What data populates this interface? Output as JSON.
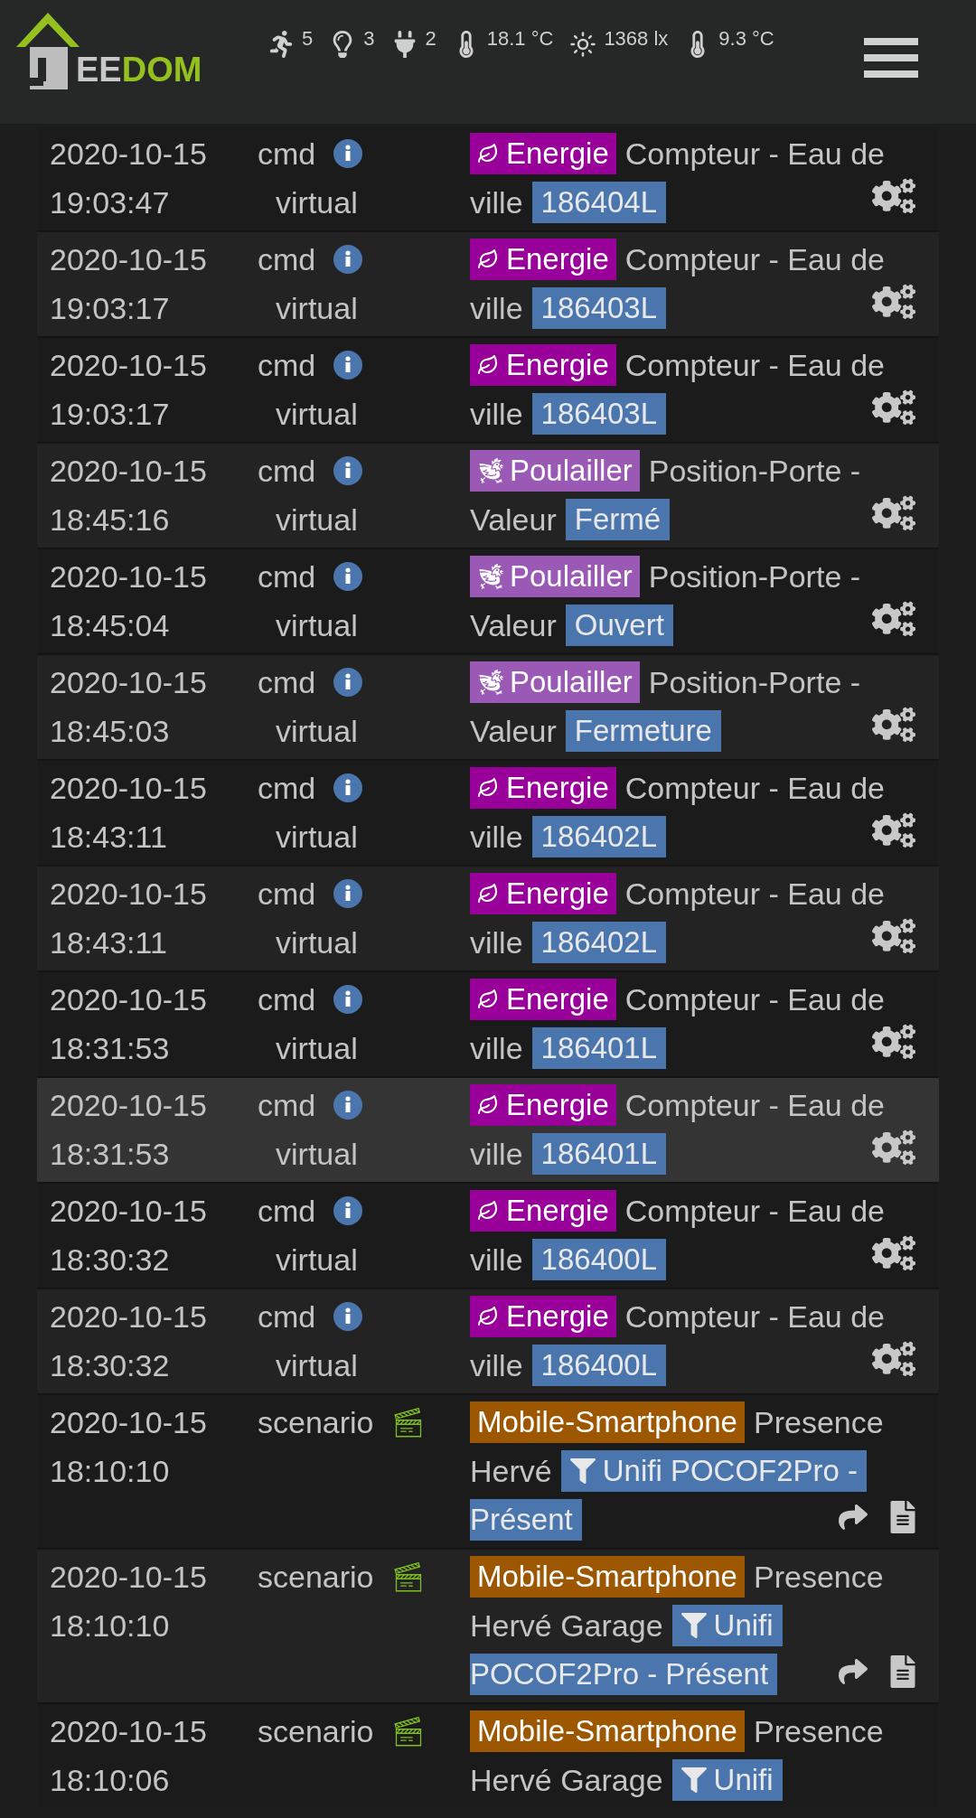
{
  "header": {
    "logo": {
      "grey": "EE",
      "green": "DOM"
    },
    "status": [
      {
        "kind": "motion",
        "value": "5"
      },
      {
        "kind": "light",
        "value": "3"
      },
      {
        "kind": "plug",
        "value": "2"
      },
      {
        "kind": "thermometer",
        "value": "18.1 °C"
      },
      {
        "kind": "sun",
        "value": "1368 lx"
      },
      {
        "kind": "thermometer",
        "value": "9.3 °C"
      }
    ]
  },
  "rows": [
    {
      "kind": "cmd",
      "date": "2020-10-15",
      "time": "19:03:47",
      "type": "cmd",
      "subtype": "virtual",
      "tag": {
        "kind": "energy",
        "label": "Energie",
        "color": "#990099"
      },
      "text": [
        "Compteur - Eau de",
        "ville"
      ],
      "value": [
        "186404L"
      ],
      "selected": false
    },
    {
      "kind": "cmd",
      "date": "2020-10-15",
      "time": "19:03:17",
      "type": "cmd",
      "subtype": "virtual",
      "tag": {
        "kind": "energy",
        "label": "Energie",
        "color": "#990099"
      },
      "text": [
        "Compteur - Eau de",
        "ville"
      ],
      "value": [
        "186403L"
      ],
      "selected": false
    },
    {
      "kind": "cmd",
      "date": "2020-10-15",
      "time": "19:03:17",
      "type": "cmd",
      "subtype": "virtual",
      "tag": {
        "kind": "energy",
        "label": "Energie",
        "color": "#990099"
      },
      "text": [
        "Compteur - Eau de",
        "ville"
      ],
      "value": [
        "186403L"
      ],
      "selected": false
    },
    {
      "kind": "cmd",
      "date": "2020-10-15",
      "time": "18:45:16",
      "type": "cmd",
      "subtype": "virtual",
      "tag": {
        "kind": "chicken",
        "label": "Poulailler",
        "color": "#9b59b6"
      },
      "text": [
        "Position-Porte -",
        "Valeur"
      ],
      "value": [
        "Fermé"
      ],
      "selected": false
    },
    {
      "kind": "cmd",
      "date": "2020-10-15",
      "time": "18:45:04",
      "type": "cmd",
      "subtype": "virtual",
      "tag": {
        "kind": "chicken",
        "label": "Poulailler",
        "color": "#9b59b6"
      },
      "text": [
        "Position-Porte -",
        "Valeur"
      ],
      "value": [
        "Ouvert"
      ],
      "selected": false
    },
    {
      "kind": "cmd",
      "date": "2020-10-15",
      "time": "18:45:03",
      "type": "cmd",
      "subtype": "virtual",
      "tag": {
        "kind": "chicken",
        "label": "Poulailler",
        "color": "#9b59b6"
      },
      "text": [
        "Position-Porte -",
        "Valeur"
      ],
      "value": [
        "Fermeture"
      ],
      "selected": false
    },
    {
      "kind": "cmd",
      "date": "2020-10-15",
      "time": "18:43:11",
      "type": "cmd",
      "subtype": "virtual",
      "tag": {
        "kind": "energy",
        "label": "Energie",
        "color": "#990099"
      },
      "text": [
        "Compteur - Eau de",
        "ville"
      ],
      "value": [
        "186402L"
      ],
      "selected": false
    },
    {
      "kind": "cmd",
      "date": "2020-10-15",
      "time": "18:43:11",
      "type": "cmd",
      "subtype": "virtual",
      "tag": {
        "kind": "energy",
        "label": "Energie",
        "color": "#990099"
      },
      "text": [
        "Compteur - Eau de",
        "ville"
      ],
      "value": [
        "186402L"
      ],
      "selected": false
    },
    {
      "kind": "cmd",
      "date": "2020-10-15",
      "time": "18:31:53",
      "type": "cmd",
      "subtype": "virtual",
      "tag": {
        "kind": "energy",
        "label": "Energie",
        "color": "#990099"
      },
      "text": [
        "Compteur - Eau de",
        "ville"
      ],
      "value": [
        "186401L"
      ],
      "selected": false
    },
    {
      "kind": "cmd",
      "date": "2020-10-15",
      "time": "18:31:53",
      "type": "cmd",
      "subtype": "virtual",
      "tag": {
        "kind": "energy",
        "label": "Energie",
        "color": "#990099"
      },
      "text": [
        "Compteur - Eau de",
        "ville"
      ],
      "value": [
        "186401L"
      ],
      "selected": true
    },
    {
      "kind": "cmd",
      "date": "2020-10-15",
      "time": "18:30:32",
      "type": "cmd",
      "subtype": "virtual",
      "tag": {
        "kind": "energy",
        "label": "Energie",
        "color": "#990099"
      },
      "text": [
        "Compteur - Eau de",
        "ville"
      ],
      "value": [
        "186400L"
      ],
      "selected": false
    },
    {
      "kind": "cmd",
      "date": "2020-10-15",
      "time": "18:30:32",
      "type": "cmd",
      "subtype": "virtual",
      "tag": {
        "kind": "energy",
        "label": "Energie",
        "color": "#990099"
      },
      "text": [
        "Compteur - Eau de",
        "ville"
      ],
      "value": [
        "186400L"
      ],
      "selected": false
    },
    {
      "kind": "scenario",
      "date": "2020-10-15",
      "time": "18:10:10",
      "type": "scenario",
      "tag": {
        "kind": "plain",
        "label": "Mobile-Smartphone",
        "color": "#9c5700"
      },
      "text": [
        "Presence",
        "Hervé"
      ],
      "value": [
        "Unifi POCOF2Pro -",
        "Présent"
      ],
      "selected": false
    },
    {
      "kind": "scenario",
      "date": "2020-10-15",
      "time": "18:10:10",
      "type": "scenario",
      "tag": {
        "kind": "plain",
        "label": "Mobile-Smartphone",
        "color": "#9c5700"
      },
      "text": [
        "Presence",
        "Hervé Garage"
      ],
      "value": [
        "Unifi",
        "POCOF2Pro - Présent"
      ],
      "selected": false
    },
    {
      "kind": "scenario_cut",
      "date": "2020-10-15",
      "time": "18:10:06",
      "type": "scenario",
      "tag": {
        "kind": "plain",
        "label": "Mobile-Smartphone",
        "color": "#9c5700"
      },
      "text": [
        "Presence",
        "Hervé Garage"
      ],
      "value": [
        "Unifi"
      ],
      "selected": false
    }
  ]
}
